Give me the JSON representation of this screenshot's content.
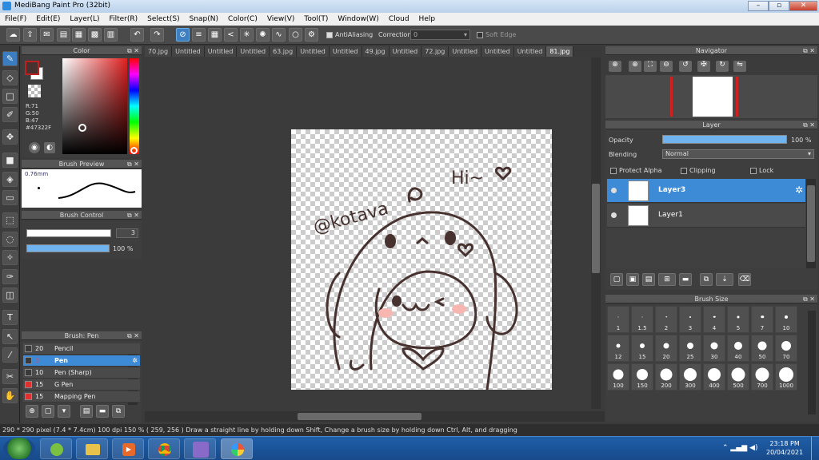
{
  "window": {
    "title": "MediBang Paint Pro (32bit)"
  },
  "menu": [
    "File(F)",
    "Edit(E)",
    "Layer(L)",
    "Filter(R)",
    "Select(S)",
    "Snap(N)",
    "Color(C)",
    "View(V)",
    "Tool(T)",
    "Window(W)",
    "Cloud",
    "Help"
  ],
  "toolbar": {
    "antialiasing_label": "AntiAliasing",
    "correction_label": "Correction",
    "correction_value": "0",
    "soft_edge_label": "Soft Edge"
  },
  "tabs": [
    "70.jpg",
    "Untitled",
    "Untitled",
    "Untitled",
    "63.jpg",
    "Untitled",
    "Untitled",
    "49.jpg",
    "Untitled",
    "72.jpg",
    "Untitled",
    "Untitled",
    "Untitled",
    "81.jpg"
  ],
  "color_panel": {
    "title": "Color",
    "r": "R:71",
    "g": "G:50",
    "b": "B:47",
    "hex": "#47322F",
    "fg_color": "#47322f"
  },
  "brush_preview": {
    "title": "Brush Preview",
    "size": "0.76mm"
  },
  "brush_control": {
    "title": "Brush Control",
    "size": "3",
    "opacity": "100 %"
  },
  "brush_list": {
    "title": "Brush: Pen",
    "items": [
      {
        "num": "20",
        "name": "Pencil",
        "color": "#3a3a3a",
        "selected": false
      },
      {
        "num": "3",
        "name": "Pen",
        "color": "#3a3a3a",
        "selected": true
      },
      {
        "num": "10",
        "name": "Pen (Sharp)",
        "color": "#3a3a3a",
        "selected": false
      },
      {
        "num": "15",
        "name": "G Pen",
        "color": "#e03030",
        "selected": false
      },
      {
        "num": "15",
        "name": "Mapping Pen",
        "color": "#e03030",
        "selected": false
      }
    ]
  },
  "canvas": {
    "greeting": "Hi~",
    "signature": "@kotava"
  },
  "navigator": {
    "title": "Navigator"
  },
  "layer_panel": {
    "title": "Layer",
    "opacity_label": "Opacity",
    "opacity_value": "100 %",
    "blending_label": "Blending",
    "blending_value": "Normal",
    "protect_alpha": "Protect Alpha",
    "clipping": "Clipping",
    "lock": "Lock",
    "layers": [
      {
        "name": "Layer3",
        "selected": true
      },
      {
        "name": "Layer1",
        "selected": false
      }
    ]
  },
  "brush_size": {
    "title": "Brush Size",
    "sizes": [
      "1",
      "1.5",
      "2",
      "3",
      "4",
      "5",
      "7",
      "10",
      "12",
      "15",
      "20",
      "25",
      "30",
      "40",
      "50",
      "70",
      "100",
      "150",
      "200",
      "300",
      "400",
      "500",
      "700",
      "1000"
    ]
  },
  "status": "290 * 290 pixel   (7.4 * 7.4cm)   100 dpi   150 %   ( 259, 256 )   Draw a straight line by holding down Shift, Change a brush size by holding down Ctrl, Alt, and dragging",
  "taskbar": {
    "time": "23:18 PM",
    "date": "20/04/2021"
  }
}
